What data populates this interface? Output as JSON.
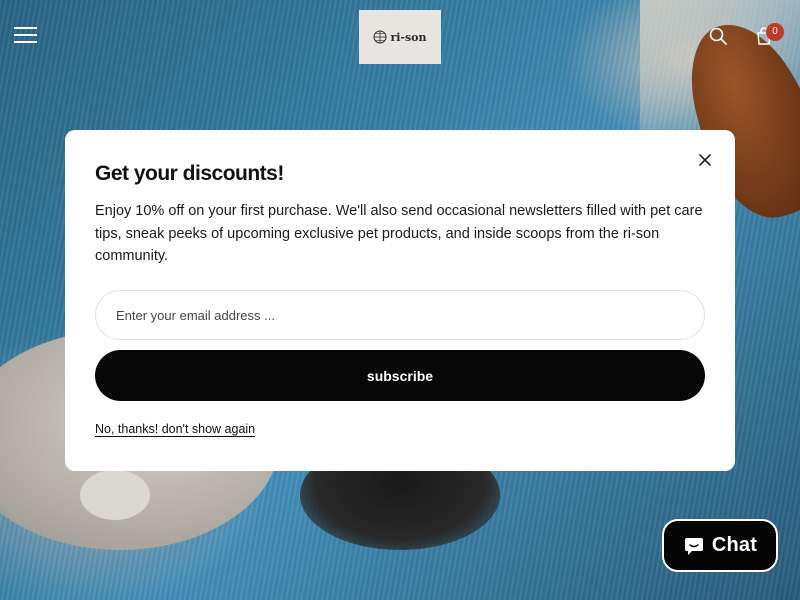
{
  "header": {
    "logo_text": "ri-son",
    "cart_count": "0"
  },
  "icons": {
    "menu": "hamburger-icon",
    "search": "search-icon",
    "cart": "cart-icon",
    "close": "close-icon",
    "chat": "chat-bubble-icon"
  },
  "modal": {
    "title": "Get your discounts!",
    "description": "Enjoy 10% off on your first purchase. We'll also send occasional newsletters filled with pet care tips, sneak peeks of upcoming exclusive pet products, and inside scoops from the ri-son community.",
    "email_placeholder": "Enter your email address ...",
    "email_value": "",
    "subscribe_label": "subscribe",
    "dismiss_label": "No, thanks! don't show again"
  },
  "chat": {
    "label": "Chat"
  },
  "colors": {
    "modal_bg": "#ffffff",
    "button_bg": "#070707",
    "badge": "#c0392b",
    "logo_bg": "#e9e6e1"
  }
}
